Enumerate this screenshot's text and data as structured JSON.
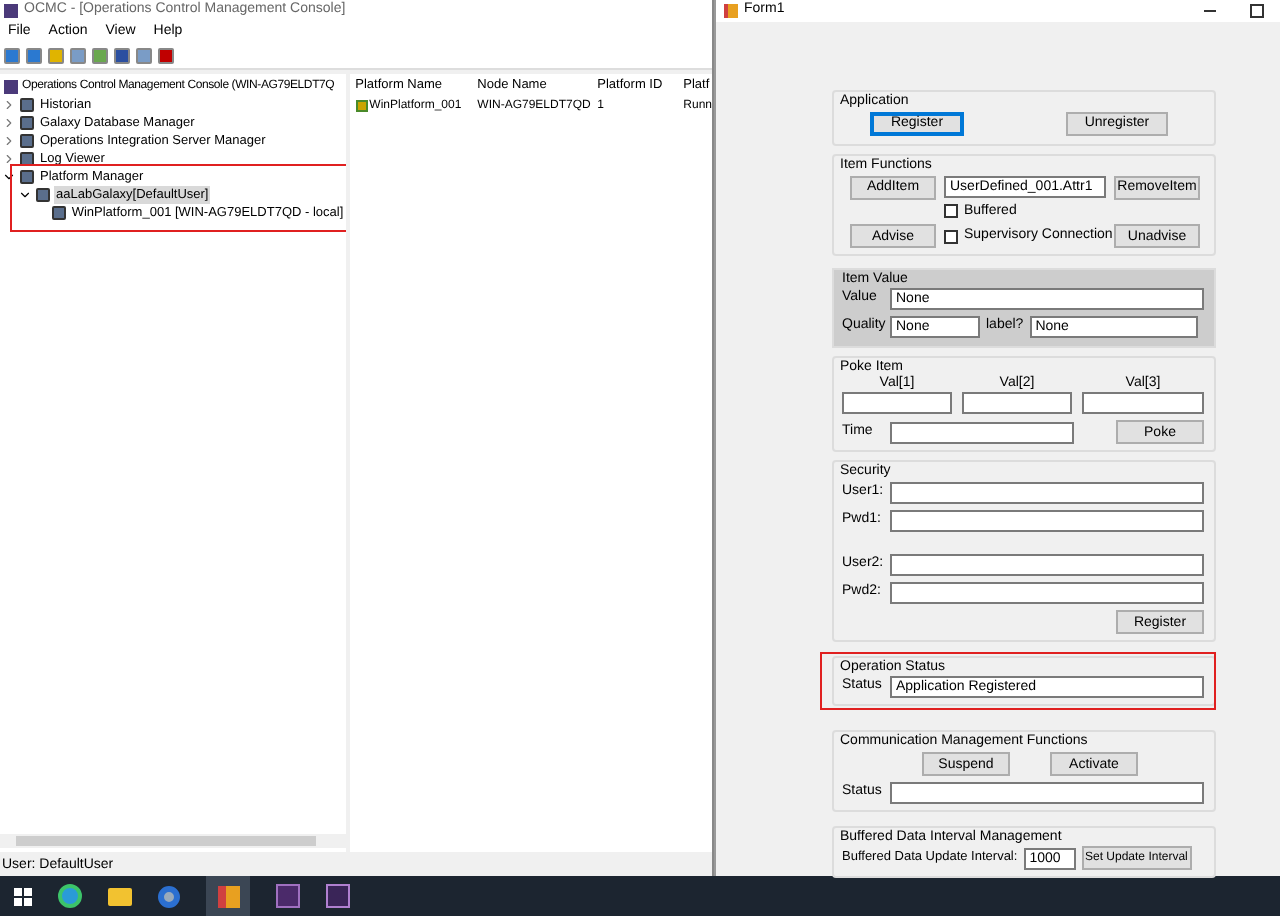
{
  "console": {
    "title": "OCMC - [Operations Control Management Console]",
    "menu": [
      "File",
      "Action",
      "View",
      "Help"
    ],
    "tree_root": "Operations Control Management Console (WIN-AG79ELDT7Q",
    "tree": [
      {
        "label": "Historian",
        "expanded": false
      },
      {
        "label": "Galaxy Database Manager",
        "expanded": false
      },
      {
        "label": "Operations Integration Server Manager",
        "expanded": false
      },
      {
        "label": "Log Viewer",
        "expanded": false
      },
      {
        "label": "Platform Manager",
        "expanded": true,
        "children": [
          {
            "label": "aaLabGalaxy[DefaultUser]",
            "expanded": true,
            "selected": true,
            "children": [
              {
                "label": "WinPlatform_001 [WIN-AG79ELDT7QD - local]",
                "selected": false
              }
            ]
          }
        ]
      }
    ],
    "list": {
      "columns": [
        "Platform Name",
        "Node Name",
        "Platform ID",
        "Platf"
      ],
      "rows": [
        [
          "WinPlatform_001",
          "WIN-AG79ELDT7QD",
          "1",
          "Runn"
        ]
      ]
    },
    "status_bar": "User: DefaultUser"
  },
  "form": {
    "title": "Form1",
    "application": {
      "title": "Application",
      "buttons": [
        {
          "label": "Register",
          "focused": true
        },
        {
          "label": "Unregister",
          "focused": false
        }
      ]
    },
    "item_functions": {
      "title": "Item Functions",
      "add": "AddItem",
      "item": "UserDefined_001.Attr1",
      "remove": "RemoveItem",
      "buffered": {
        "label": "Buffered",
        "checked": false
      },
      "supervisory": {
        "label": "Supervisory Connection",
        "checked": false
      },
      "advise": "Advise",
      "unadvise": "Unadvise"
    },
    "item_value": {
      "title": "Item Value",
      "value_label": "Value",
      "value": "None",
      "quality_label": "Quality",
      "quality": "None",
      "label_label": "label?",
      "label_value": "None"
    },
    "poke_item": {
      "title": "Poke Item",
      "columns": [
        "Val[1]",
        "Val[2]",
        "Val[3]"
      ],
      "time_label": "Time",
      "button": "Poke"
    },
    "security": {
      "title": "Security",
      "fields": [
        "User1:",
        "Pwd1:",
        "User2:",
        "Pwd2:"
      ],
      "button": "Register"
    },
    "operation_status": {
      "title": "Operation Status",
      "status_label": "Status",
      "status": "Application Registered"
    },
    "communication": {
      "title": "Communication Management Functions",
      "buttons": [
        "Suspend",
        "Activate"
      ],
      "status_label": "Status"
    },
    "buffered_interval": {
      "title": "Buffered Data Interval Management",
      "label": "Buffered Data Update Interval:",
      "value": "1000",
      "button": "Set Update Interval"
    }
  }
}
